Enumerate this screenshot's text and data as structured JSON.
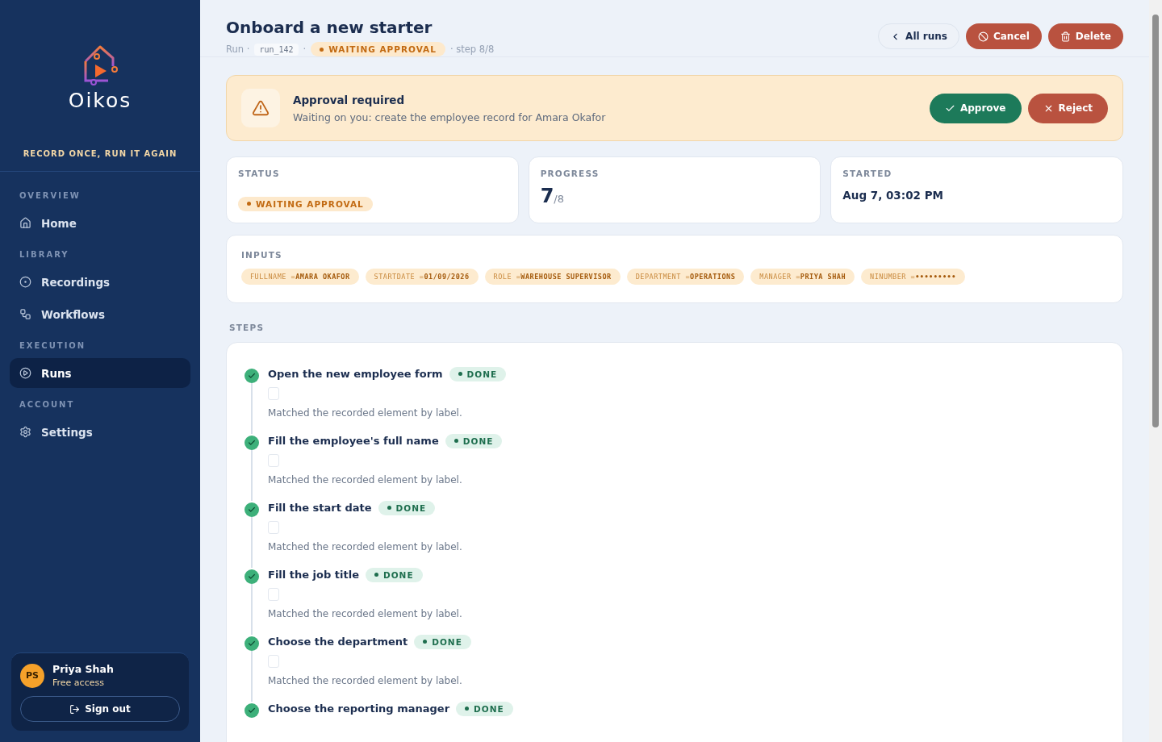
{
  "brand": {
    "name": "Oikos",
    "tagline": "RECORD ONCE, RUN IT AGAIN"
  },
  "nav": [
    {
      "heading": "OVERVIEW",
      "items": [
        {
          "label": "Home",
          "selected": false
        }
      ]
    },
    {
      "heading": "LIBRARY",
      "items": [
        {
          "label": "Recordings",
          "selected": false
        },
        {
          "label": "Workflows",
          "selected": false
        }
      ]
    },
    {
      "heading": "EXECUTION",
      "items": [
        {
          "label": "Runs",
          "selected": true
        }
      ]
    },
    {
      "heading": "ACCOUNT",
      "items": [
        {
          "label": "Settings",
          "selected": false
        }
      ]
    }
  ],
  "user": {
    "initials": "PS",
    "name": "Priya Shah",
    "plan": "Free access",
    "sign_out": "Sign out"
  },
  "header": {
    "title": "Onboard a new starter",
    "run_label": "Run ·",
    "run_id": "run_142",
    "sep": "·",
    "status": "WAITING APPROVAL",
    "step": "· step 8/8",
    "buttons": [
      {
        "label": "All runs",
        "kind": "back"
      },
      {
        "label": "Cancel",
        "kind": "cancel"
      },
      {
        "label": "Delete",
        "kind": "delete"
      }
    ]
  },
  "approval": {
    "title": "Approval required",
    "message": "Waiting on you: create the employee record for Amara Okafor",
    "buttons": [
      {
        "label": "Approve",
        "kind": "approve"
      },
      {
        "label": "Reject",
        "kind": "reject"
      }
    ]
  },
  "stats": {
    "status": {
      "label": "STATUS",
      "value": "WAITING APPROVAL"
    },
    "progress": {
      "label": "PROGRESS",
      "done": "7",
      "total": "/8"
    },
    "started": {
      "label": "STARTED",
      "value": "Aug 7, 03:02 PM"
    }
  },
  "inputs": {
    "label": "INPUTS",
    "items": [
      {
        "key": "FULLNAME =",
        "value": "AMARA OKAFOR"
      },
      {
        "key": "STARTDATE =",
        "value": "01/09/2026"
      },
      {
        "key": "ROLE =",
        "value": "WAREHOUSE SUPERVISOR"
      },
      {
        "key": "DEPARTMENT =",
        "value": "OPERATIONS"
      },
      {
        "key": "MANAGER =",
        "value": "PRIYA SHAH"
      },
      {
        "key": "NINUMBER =",
        "value": "•••••••••"
      }
    ]
  },
  "steps_label": "STEPS",
  "steps": [
    {
      "title": "Open the new employee form",
      "status": "DONE",
      "kind": "done",
      "note": "Matched the recorded element by label."
    },
    {
      "title": "Fill the employee's full name",
      "status": "DONE",
      "kind": "done",
      "note": "Matched the recorded element by label."
    },
    {
      "title": "Fill the start date",
      "status": "DONE",
      "kind": "done",
      "note": "Matched the recorded element by label."
    },
    {
      "title": "Fill the job title",
      "status": "DONE",
      "kind": "done",
      "note": "Matched the recorded element by label."
    },
    {
      "title": "Choose the department",
      "status": "DONE",
      "kind": "done",
      "note": "Matched the recorded element by label."
    },
    {
      "title": "Choose the reporting manager",
      "status": "DONE",
      "kind": "done"
    }
  ]
}
